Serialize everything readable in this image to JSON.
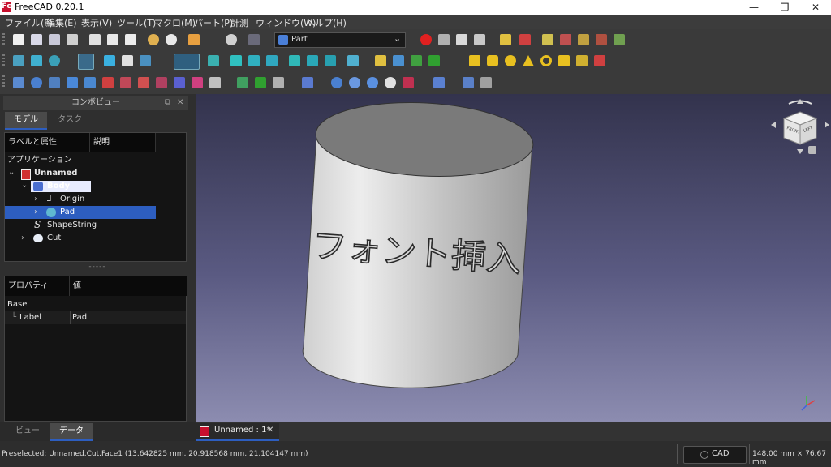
{
  "window": {
    "title": "FreeCAD 0.20.1",
    "logo_text": "Fc",
    "controls": {
      "minimize": "—",
      "maximize": "❐",
      "close": "✕"
    }
  },
  "menubar": {
    "items": [
      "ファイル(F)",
      "編集(E)",
      "表示(V)",
      "ツール(T)",
      "マクロ(M)",
      "パート(P)",
      "計測",
      "ウィンドウ(W)",
      "ヘルプ(H)"
    ]
  },
  "toolbar": {
    "workbench_selector": {
      "value": "Part",
      "arrow": "⌄"
    }
  },
  "combo_view": {
    "title": "コンボビュー",
    "title_buttons": [
      "⧉",
      "✕"
    ],
    "tabs": [
      {
        "label": "モデル",
        "active": true
      },
      {
        "label": "タスク",
        "active": false
      }
    ],
    "tree_columns": [
      "ラベルと属性",
      "説明"
    ],
    "tree_root": "アプリケーション",
    "tree_items": [
      {
        "label": "Unnamed",
        "bold": true
      },
      {
        "label": "Body"
      },
      {
        "label": "Origin"
      },
      {
        "label": "Pad",
        "selected": true
      },
      {
        "label": "ShapeString"
      },
      {
        "label": "Cut"
      }
    ],
    "tree_icons": {
      "expanded": "⌄",
      "collapsed": "›",
      "shapestring": "S",
      "origin": "⅃"
    },
    "splitter": "-----",
    "property_columns": [
      "プロパティ",
      "値"
    ],
    "property_group": "Base",
    "property_rows": [
      {
        "name": "Label",
        "value": "Pad"
      }
    ],
    "bottom_tabs": [
      {
        "label": "ビュー",
        "active": false
      },
      {
        "label": "データ",
        "active": true
      }
    ]
  },
  "viewport": {
    "engraved_text": "フォント挿入",
    "navcube_faces": {
      "front": "FRONT",
      "side": "LEFT"
    }
  },
  "document_tab": {
    "label": "Unnamed : 1*",
    "close": "✕"
  },
  "statusbar": {
    "message": "Preselected: Unnamed.Cut.Face1 (13.642825 mm, 20.918568 mm, 21.104147 mm)",
    "nav_style": "CAD",
    "dimensions": "148.00 mm × 76.67 mm"
  },
  "colors": {
    "accent_selected": "#2d5ec0",
    "record_red": "#e02020"
  }
}
